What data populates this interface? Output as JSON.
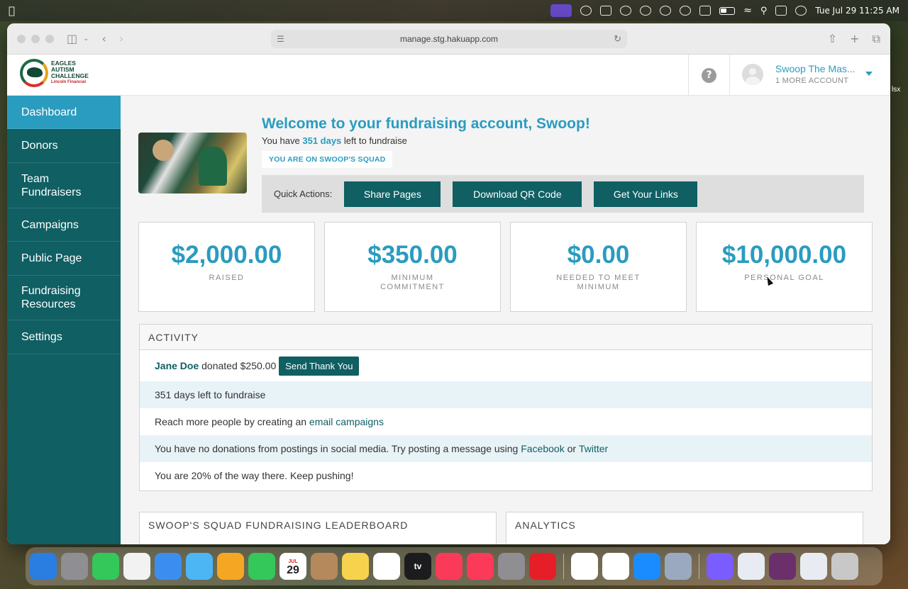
{
  "menubar": {
    "clock": "Tue Jul 29  11:25 AM"
  },
  "browser": {
    "url": "manage.stg.hakuapp.com"
  },
  "header": {
    "logo_line1": "EAGLES",
    "logo_line2": "AUTISM",
    "logo_line3": "CHALLENGE",
    "logo_sponsor": "Lincoln Financial",
    "help_symbol": "?",
    "account_name": "Swoop The Mas...",
    "account_sub": "1 MORE ACCOUNT"
  },
  "sidebar": {
    "items": [
      {
        "label": "Dashboard"
      },
      {
        "label": "Donors"
      },
      {
        "label": "Team Fundraisers"
      },
      {
        "label": "Campaigns"
      },
      {
        "label": "Public Page"
      },
      {
        "label": "Fundraising Resources"
      },
      {
        "label": "Settings"
      }
    ]
  },
  "welcome": {
    "title": "Welcome to your fundraising account, Swoop!",
    "days_prefix": "You have ",
    "days_value": "351 days",
    "days_suffix": " left to fundraise",
    "squad_badge": "YOU ARE ON SWOOP'S SQUAD"
  },
  "quick_actions": {
    "label": "Quick Actions:",
    "buttons": [
      {
        "label": "Share Pages"
      },
      {
        "label": "Download QR Code"
      },
      {
        "label": "Get Your Links"
      }
    ]
  },
  "stats": [
    {
      "value": "$2,000.00",
      "label": "RAISED"
    },
    {
      "value": "$350.00",
      "label": "MINIMUM COMMITMENT"
    },
    {
      "value": "$0.00",
      "label": "NEEDED TO MEET MINIMUM"
    },
    {
      "value": "$10,000.00",
      "label": "PERSONAL GOAL"
    }
  ],
  "activity": {
    "title": "ACTIVITY",
    "donor_name": "Jane Doe",
    "donation_text": " donated $250.00",
    "thanks_button": "Send Thank You",
    "row2": "351 days left to fundraise",
    "row3_prefix": "Reach more people by creating an ",
    "row3_link": "email campaigns",
    "row4_prefix": "You have no donations from postings in social media. Try posting a message using ",
    "row4_link1": "Facebook",
    "row4_mid": " or ",
    "row4_link2": "Twitter",
    "row5": "You are 20% of the way there. Keep pushing!"
  },
  "panels": {
    "leaderboard_title": "SWOOP'S SQUAD FUNDRAISING LEADERBOARD",
    "analytics_title": "ANALYTICS"
  },
  "edge_text": "lsx",
  "dock": {
    "calendar_month": "JUL",
    "calendar_day": "29",
    "tv_label": "tv",
    "colors": [
      "#2a7de1",
      "#8e8e93",
      "#34c759",
      "#f2f2f2",
      "#3b8ef0",
      "#4cb6f5",
      "#f5a623",
      "#34c759",
      "#ffffff",
      "#b5895b",
      "#f7d24c",
      "#ffffff",
      "#1c1c1e",
      "#fb3a5a",
      "#fb3a5a",
      "#8e8e93",
      "#e61e28",
      "#ffffff",
      "#ffffff",
      "#1a8cff",
      "#9aa9c0",
      "#7a5cff",
      "#e8ecf2",
      "#6b2f6b",
      "#e8ecf2",
      "#c8c8c8"
    ]
  }
}
